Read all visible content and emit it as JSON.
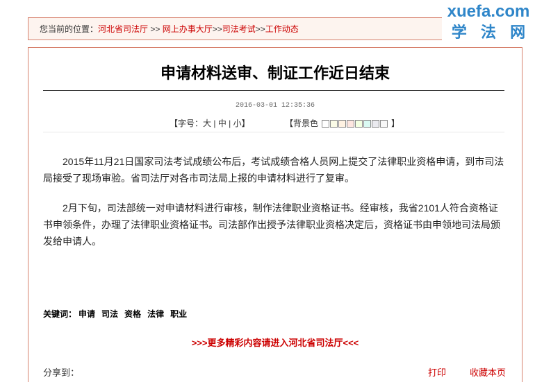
{
  "watermark": {
    "site": "xuefa.com",
    "name": "学 法 网"
  },
  "breadcrumb": {
    "label": "您当前的位置：",
    "items": [
      "河北省司法厅",
      "网上办事大厅",
      "司法考试",
      "工作动态"
    ],
    "separators": [
      " >> ",
      ">>",
      ">>"
    ]
  },
  "article": {
    "title": "申请材料送审、制证工作近日结束",
    "datetime": "2016-03-01 12:35:36",
    "font_size_tool": {
      "open": "【字号：",
      "large": "大",
      "medium": "中",
      "small": "小",
      "separator": " | ",
      "close": "】"
    },
    "background_tool": {
      "label": "【背景色",
      "close": "】",
      "swatches": [
        "#ffffff",
        "#fafbe6",
        "#fff2e2",
        "#fde6e0",
        "#f3ffe1",
        "#dafaf3",
        "#eaeaef",
        "#f7f7f7"
      ]
    },
    "paragraphs": [
      "2015年11月21日国家司法考试成绩公布后，考试成绩合格人员网上提交了法律职业资格申请，到市司法局接受了现场审验。省司法厅对各市司法局上报的申请材料进行了复审。",
      "2月下旬，司法部统一对申请材料进行审核，制作法律职业资格证书。经审核，我省2101人符合资格证书申领条件，办理了法律职业资格证书。司法部作出授予法律职业资格决定后，资格证书由申领地司法局颁发给申请人。"
    ],
    "keywords": {
      "label": "关键词：",
      "items": [
        "申请",
        "司法",
        "资格",
        "法律",
        "职业"
      ]
    }
  },
  "more_link": ">>>更多精彩内容请进入河北省司法厅<<<",
  "footer": {
    "share_label": "分享到：",
    "print": "打印",
    "favorite": "收藏本页"
  },
  "colors": {
    "link": "#cc0000",
    "border": "#d6806c",
    "breadcrumb_bg": "#fdf4ef",
    "watermark": "#2f86c9",
    "text": "#222222"
  }
}
